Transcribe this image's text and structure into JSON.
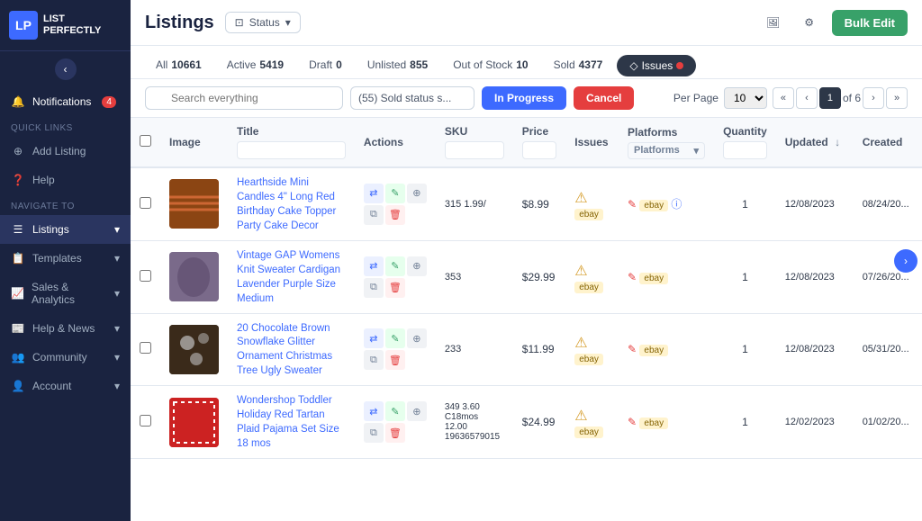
{
  "sidebar": {
    "logo_text": "LIST\nPERFECTLY",
    "back_arrow": "‹",
    "notifications_label": "Notifications",
    "notifications_badge": "4",
    "quick_links_label": "QUICK LINKS",
    "add_listing_label": "Add Listing",
    "help_label": "Help",
    "navigate_to_label": "NAVIGATE TO",
    "listings_label": "Listings",
    "templates_label": "Templates",
    "sales_analytics_label": "Sales & Analytics",
    "help_news_label": "Help & News",
    "community_label": "Community",
    "account_label": "Account"
  },
  "topbar": {
    "title": "Listings",
    "status_label": "Status",
    "bulk_edit_label": "Bulk Edit"
  },
  "tabs": [
    {
      "id": "all",
      "label": "All",
      "count": "10661"
    },
    {
      "id": "active",
      "label": "Active",
      "count": "5419"
    },
    {
      "id": "draft",
      "label": "Draft",
      "count": "0"
    },
    {
      "id": "unlisted",
      "label": "Unlisted",
      "count": "855"
    },
    {
      "id": "out-of-stock",
      "label": "Out of Stock",
      "count": "10"
    },
    {
      "id": "sold",
      "label": "Sold",
      "count": "4377"
    },
    {
      "id": "issues",
      "label": "Issues",
      "dot": true
    }
  ],
  "filter_bar": {
    "search_placeholder": "Search everything",
    "filter_label": "(55) Sold status s...",
    "in_progress_label": "In Progress",
    "cancel_label": "Cancel",
    "per_page_label": "Per Page",
    "per_page_value": "10",
    "current_page": "1",
    "total_pages": "6"
  },
  "table": {
    "columns": [
      "",
      "Image",
      "Title",
      "Actions",
      "SKU",
      "Price",
      "Issues",
      "Platforms",
      "Quantity",
      "Updated",
      "Created"
    ],
    "platforms_placeholder": "Platforms",
    "rows": [
      {
        "title": "Hearthside Mini Candles 4\" Long Red Birthday Cake Topper Party Cake Decor",
        "sku": "315 1.99/",
        "price": "$8.99",
        "quantity": "1",
        "updated": "12/08/2023",
        "created": "08/24/20..."
      },
      {
        "title": "Vintage GAP Womens Knit Sweater Cardigan Lavender Purple Size Medium",
        "sku": "353",
        "price": "$29.99",
        "quantity": "1",
        "updated": "12/08/2023",
        "created": "07/26/20..."
      },
      {
        "title": "20 Chocolate Brown Snowflake Glitter Ornament Christmas Tree Ugly Sweater",
        "sku": "233",
        "price": "$11.99",
        "quantity": "1",
        "updated": "12/08/2023",
        "created": "05/31/20..."
      },
      {
        "title": "Wondershop Toddler Holiday Red Tartan Plaid Pajama Set Size 18 mos",
        "sku": "349 3.60\nC18mos\n12.00\n19636579015",
        "price": "$24.99",
        "quantity": "1",
        "updated": "12/02/2023",
        "created": "01/02/20..."
      }
    ]
  },
  "icons": {
    "bell": "🔔",
    "plus": "+",
    "question": "?",
    "list": "☰",
    "chevron_down": "▾",
    "chevron_up": "▴",
    "chevron_left": "‹",
    "chevron_right": "›",
    "double_left": "«",
    "double_right": "»",
    "search": "🔍",
    "gear": "⚙",
    "image": "🖼",
    "warning": "⚠",
    "edit": "✎",
    "copy": "⊕",
    "trash": "🗑",
    "share": "⇄",
    "pencil": "✏",
    "flag": "⚑",
    "arrow_right": "›",
    "arrow_left": "‹",
    "sort_down": "↓"
  },
  "colors": {
    "accent_blue": "#3d6aff",
    "sidebar_bg": "#1a2340",
    "green": "#38a169",
    "red": "#e53e3e",
    "warning_yellow": "#d69e2e"
  }
}
